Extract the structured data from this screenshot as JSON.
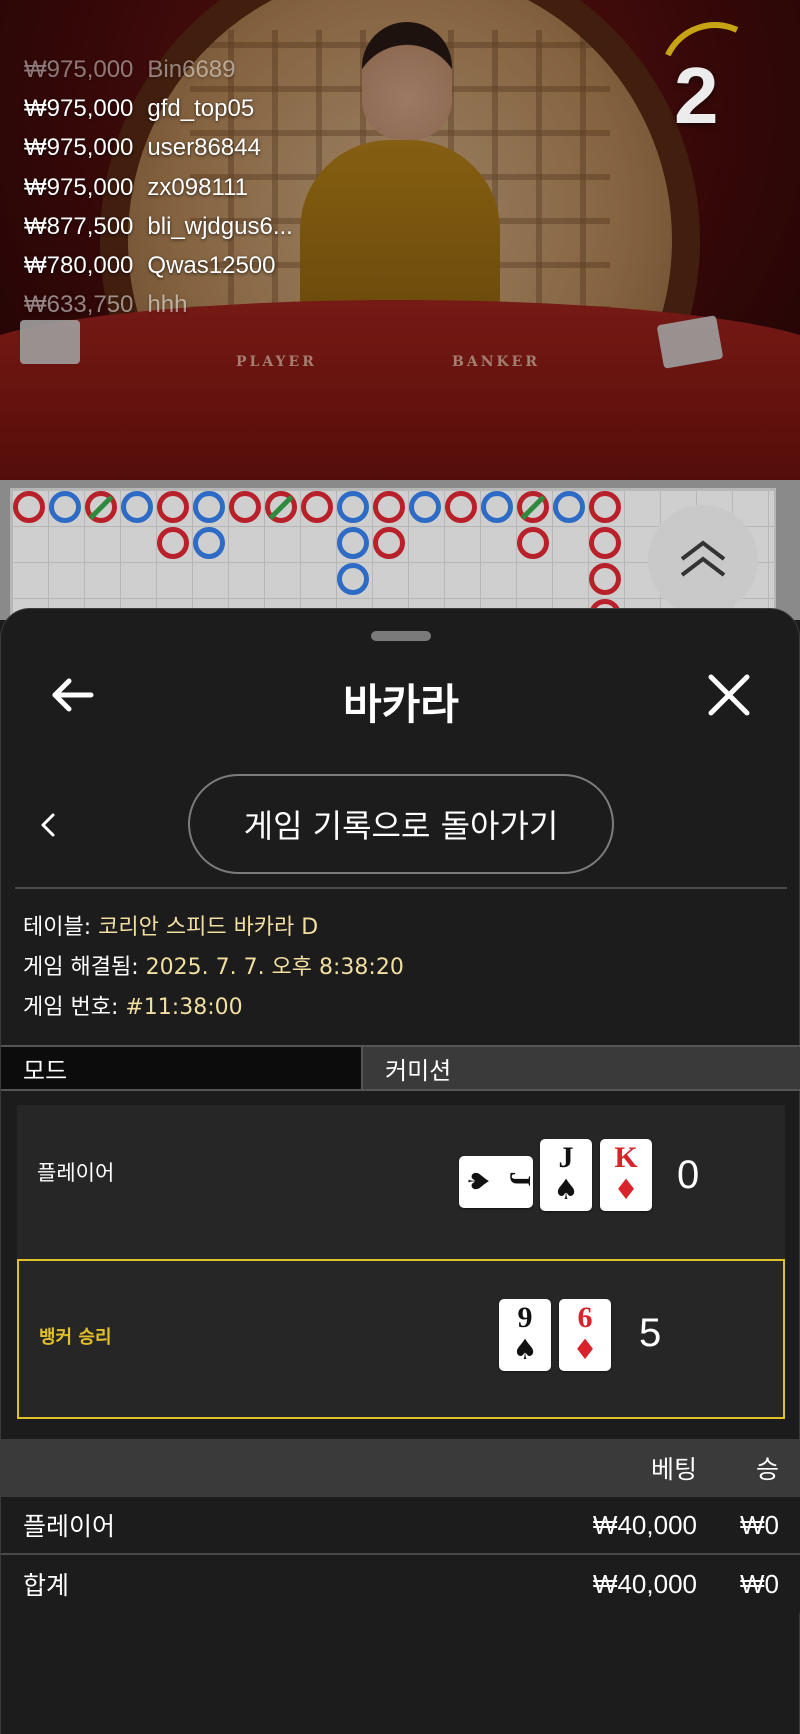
{
  "live": {
    "bets": [
      {
        "amount": "₩975,000",
        "user": "Bin6689"
      },
      {
        "amount": "₩975,000",
        "user": "gfd_top05"
      },
      {
        "amount": "₩975,000",
        "user": "user86844"
      },
      {
        "amount": "₩975,000",
        "user": "zx098111"
      },
      {
        "amount": "₩877,500",
        "user": "bli_wjdgus6..."
      },
      {
        "amount": "₩780,000",
        "user": "Qwas12500"
      },
      {
        "amount": "₩633,750",
        "user": "hhh"
      }
    ],
    "countdown": "2",
    "table_labels": {
      "player": "PLAYER",
      "banker": "BANKER"
    }
  },
  "road": {
    "colors": {
      "banker": "#b8202a",
      "player": "#2d6bc4",
      "tie": "#2f8a3d"
    },
    "columns": [
      [
        "B"
      ],
      [
        "P"
      ],
      [
        "B"
      ],
      [
        "P"
      ],
      [
        "B",
        "B"
      ],
      [
        "P",
        "P"
      ],
      [
        "B"
      ],
      [
        "B"
      ],
      [
        "B"
      ],
      [
        "P",
        "P",
        "P"
      ],
      [
        "B",
        "B"
      ],
      [
        "P"
      ],
      [
        "B"
      ],
      [
        "P"
      ],
      [
        "B",
        "B"
      ],
      [
        "P"
      ],
      [
        "B",
        "B",
        "B",
        "B"
      ]
    ]
  },
  "sheet": {
    "title": "바카라",
    "back_to_history": "게임 기록으로 돌아가기",
    "info": {
      "table_label": "테이블: ",
      "table_value": "코리안 스피드 바카라 D",
      "resolved_label": "게임 해결됨: ",
      "resolved_value": "2025. 7. 7. 오후 8:38:20",
      "number_label": "게임 번호: ",
      "number_value": "#11:38:00"
    },
    "tabs": {
      "mode": "모드",
      "commission": "커미션"
    },
    "player_hand": {
      "label": "플레이어",
      "score": "0",
      "cards": [
        {
          "rank": "J",
          "suit": "♠",
          "color": "black",
          "sideways": true
        },
        {
          "rank": "J",
          "suit": "♠",
          "color": "black",
          "sideways": false
        },
        {
          "rank": "K",
          "suit": "♦",
          "color": "red",
          "sideways": false
        }
      ]
    },
    "banker_hand": {
      "label": "뱅커 승리",
      "score": "5",
      "cards": [
        {
          "rank": "9",
          "suit": "♠",
          "color": "black"
        },
        {
          "rank": "6",
          "suit": "♦",
          "color": "red"
        }
      ]
    },
    "bet_table": {
      "headers": {
        "bet": "베팅",
        "win": "승"
      },
      "rows": [
        {
          "label": "플레이어",
          "bet": "₩40,000",
          "win": "₩0"
        },
        {
          "label": "합계",
          "bet": "₩40,000",
          "win": "₩0"
        }
      ]
    }
  }
}
